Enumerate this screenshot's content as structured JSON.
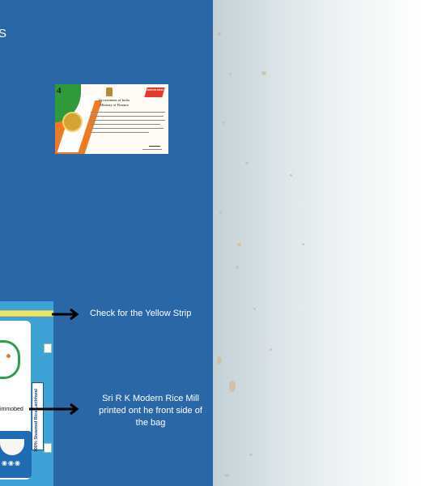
{
  "slide": {
    "cut_title_fragment": "S",
    "annotations": [
      {
        "text": "Check for the Yellow Strip"
      },
      {
        "text": "Sri R K Modern Rice Mill printed ont he front side of the bag"
      }
    ]
  },
  "certificate": {
    "badge": "4",
    "header_line1": "Government of India",
    "header_line2": "Ministry of Finance",
    "corner_logo": "NATION FIRST"
  },
  "rice_bag": {
    "side_label": "100% Steamed Rice Lachhwal",
    "front_text": "immobed",
    "strip_color": "#f0e36a"
  },
  "colors": {
    "panel_blue": "#2a67a6",
    "arrow": "#000000",
    "label_text": "#ffffff"
  },
  "icons": [
    "arrow-right-icon",
    "emblem-icon",
    "medal-icon"
  ]
}
